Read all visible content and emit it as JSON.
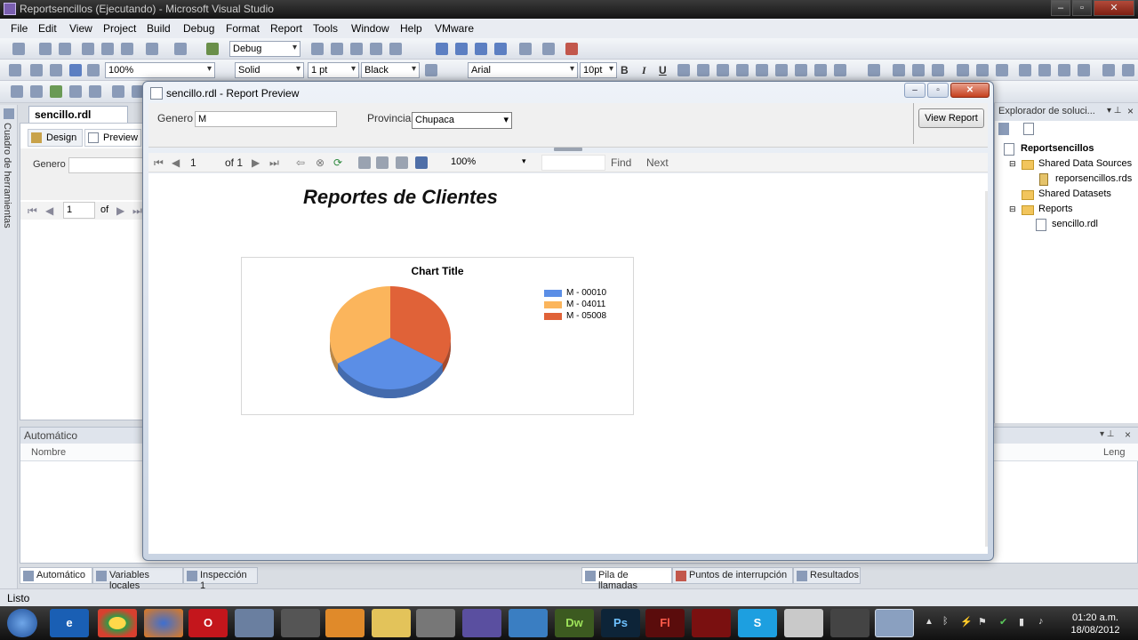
{
  "window_title": "Reportsencillos (Ejecutando) - Microsoft Visual Studio",
  "menu": [
    "File",
    "Edit",
    "View",
    "Project",
    "Build",
    "Debug",
    "Format",
    "Report",
    "Tools",
    "Window",
    "Help",
    "VMware"
  ],
  "toolbar1": {
    "config": "Debug"
  },
  "toolbar2": {
    "zoom": "100%",
    "line_style": "Solid",
    "line_width": "1 pt",
    "line_color": "Black",
    "font": "Arial",
    "size": "10pt",
    "bold": "B",
    "italic": "I",
    "underline": "U"
  },
  "toolbox_label": "Cuadro de herramientas",
  "design_doc": {
    "tab": "sencillo.rdl [Design]",
    "design_tab": "Design",
    "preview_tab": "Preview",
    "genero_label": "Genero",
    "page": "1",
    "of": "of"
  },
  "solution_explorer": {
    "title": "Explorador de soluci...",
    "items": [
      {
        "label": "Reportsencillos"
      },
      {
        "label": "Shared Data Sources"
      },
      {
        "label": "reporsencillos.rds"
      },
      {
        "label": "Shared Datasets"
      },
      {
        "label": "Reports"
      },
      {
        "label": "sencillo.rdl"
      }
    ]
  },
  "auto_panel": {
    "title": "Automático",
    "col_name": "Nombre",
    "col_lang": "Leng"
  },
  "bottom_tabs_left": [
    "Automático",
    "Variables locales",
    "Inspección 1"
  ],
  "bottom_tabs_right": [
    "Pila de llamadas",
    "Puntos de interrupción",
    "Resultados"
  ],
  "status": "Listo",
  "clock": {
    "time": "01:20 a.m.",
    "date": "18/08/2012"
  },
  "taskbar_labels": {
    "dw": "Dw",
    "ps": "Ps",
    "fl": "Fl"
  },
  "preview": {
    "title": "sencillo.rdl - Report Preview",
    "genero_label": "Genero",
    "genero_value": "M",
    "provincia_label": "Provincia",
    "provincia_value": "Chupaca",
    "view_report": "View Report",
    "page": "1",
    "of_pages": "of 1",
    "zoom": "100%",
    "find": "Find",
    "next": "Next",
    "report_title": "Reportes de Clientes"
  },
  "colors": {
    "slice1": "#5b8ee6",
    "slice2": "#fbb55c",
    "slice3": "#e06238"
  },
  "chart_data": {
    "type": "pie",
    "title": "Chart Title",
    "categories": [
      "M - 00010",
      "M - 04011",
      "M - 05008"
    ],
    "values": [
      33.3,
      33.3,
      33.4
    ],
    "legend": "right"
  }
}
